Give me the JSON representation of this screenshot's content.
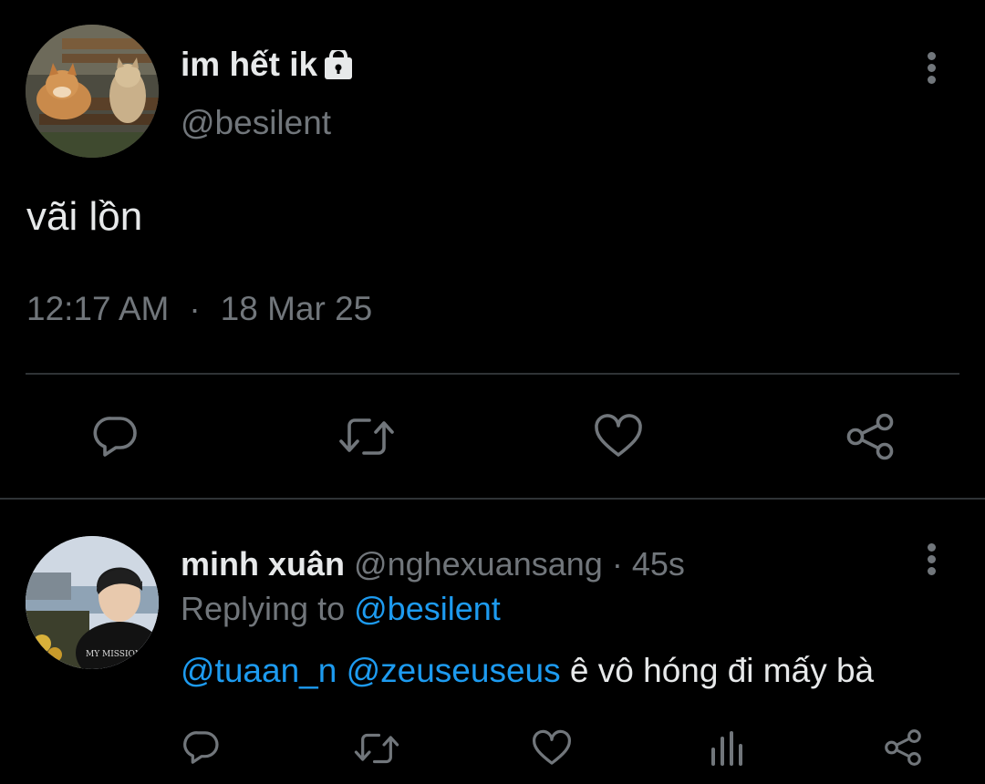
{
  "main_tweet": {
    "display_name": "im hết ik",
    "handle": "@besilent",
    "text": "vãi lồn",
    "time": "12:17 AM",
    "separator": "·",
    "date": "18 Mar 25",
    "avatar_icon": "avatar-dog-cat",
    "protected_icon": "lock-icon",
    "actions": [
      "reply-icon",
      "retweet-icon",
      "like-icon",
      "share-icon"
    ]
  },
  "reply_tweet": {
    "display_name": "minh xuân",
    "handle": "@nghexuansang",
    "separator": "·",
    "age": "45s",
    "replying_prefix": "Replying to",
    "replying_to": "@besilent",
    "mention_1": "@tuaan_n",
    "mention_2": "@zeuseuseus",
    "text": "ê vô hóng đi mấy bà",
    "avatar_icon": "avatar-person",
    "actions": [
      "reply-icon",
      "retweet-icon",
      "like-icon",
      "analytics-icon",
      "share-icon"
    ]
  },
  "colors": {
    "background": "#000000",
    "primary_text": "#e7e9ea",
    "secondary_text": "#71767b",
    "link": "#1d9bf0",
    "divider": "#2f3336"
  }
}
